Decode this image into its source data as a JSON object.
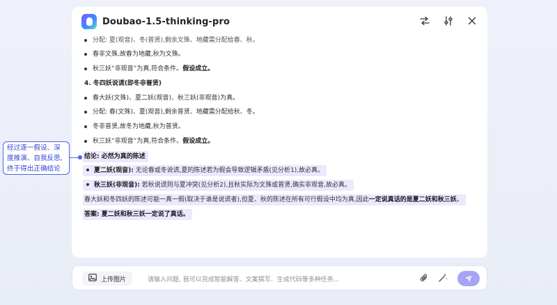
{
  "header": {
    "title": "Doubao-1.5-thinking-pro",
    "icons": [
      "swap-icon",
      "sliders-icon",
      "close-icon"
    ]
  },
  "content": {
    "cutoff_line": "分配: 夏(观音)、冬(普贤),剩余文殊、地藏需分配给春、秋。",
    "case3": [
      "春非文殊,故春为地藏,秋为文殊。",
      {
        "prefix": "秋三妖“非观音”为真,符合条件。",
        "bold": "假设成立。"
      }
    ],
    "section4_title": "4. 冬四妖说谎(即冬非普贤)",
    "case4": [
      "春大妖(文殊)、夏二妖(观音)、秋三妖(非观音)为真。",
      "分配: 春(文殊)、夏(观音),剩余普贤、地藏需分配给秋、冬。",
      "冬非普贤,故冬为地藏,秋为普贤。",
      {
        "prefix": "秋三妖“非观音”为真,符合条件。",
        "bold": "假设成立。"
      }
    ],
    "conclusion_title": "结论: 必然为真的陈述",
    "conclusion_items": [
      {
        "bold": "夏二妖(观音):",
        "text": " 无论春或冬说谎,夏的陈述若为假会导致逻辑矛盾(见分析1),故必真。"
      },
      {
        "bold": "秋三妖(非观音):",
        "text": " 若秋说谎则与夏冲突(见分析2),且秋实际为文殊或普贤,确实非观音,故必真。"
      }
    ],
    "summary": {
      "text": "春大妖和冬四妖的陈述可能一真一假(取决于谁是说谎者),但夏、秋的陈述在所有可行假设中均为真,因此",
      "bold": "一定说真话的是夏二妖和秋三妖",
      "end": "。"
    },
    "answer": "答案: 夏二妖和秋三妖一定说了真话。"
  },
  "annotation": {
    "lines": [
      "经过逐一假设、深",
      "度推演、自我反思,",
      "终于得出正确结论"
    ]
  },
  "input": {
    "upload_label": "上传图片",
    "placeholder": "请输入问题, 我可以完成智能解答、文案撰写、生成代码等多种任务...",
    "icons": [
      "paperclip-icon",
      "magic-wand-icon",
      "send-icon"
    ]
  },
  "colors": {
    "accent": "#4a66e0",
    "highlight": "#ede8fd",
    "send": "#a9a3f5"
  }
}
